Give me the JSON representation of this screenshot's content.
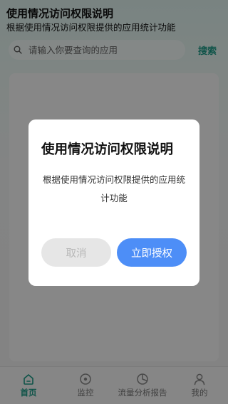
{
  "header": {
    "title": "使用情况访问权限说明",
    "subtitle": "根据使用情况访问权限提供的应用统计功能"
  },
  "search": {
    "placeholder": "请输入你要查询的应用",
    "button_label": "搜索",
    "icon": "search-icon"
  },
  "tabbar": {
    "items": [
      {
        "label": "首页",
        "icon": "home-icon",
        "active": true
      },
      {
        "label": "监控",
        "icon": "monitor-icon",
        "active": false
      },
      {
        "label": "流量分析报告",
        "icon": "pie-chart-icon",
        "active": false
      },
      {
        "label": "我的",
        "icon": "person-icon",
        "active": false
      }
    ]
  },
  "dialog": {
    "title": "使用情况访问权限说明",
    "message": "根据使用情况访问权限提供的应用统计功能",
    "cancel_label": "取消",
    "confirm_label": "立即授权"
  },
  "colors": {
    "accent": "#1a9a86",
    "primary_button": "#4d8ef7",
    "cancel_button": "#e6e6e6"
  }
}
